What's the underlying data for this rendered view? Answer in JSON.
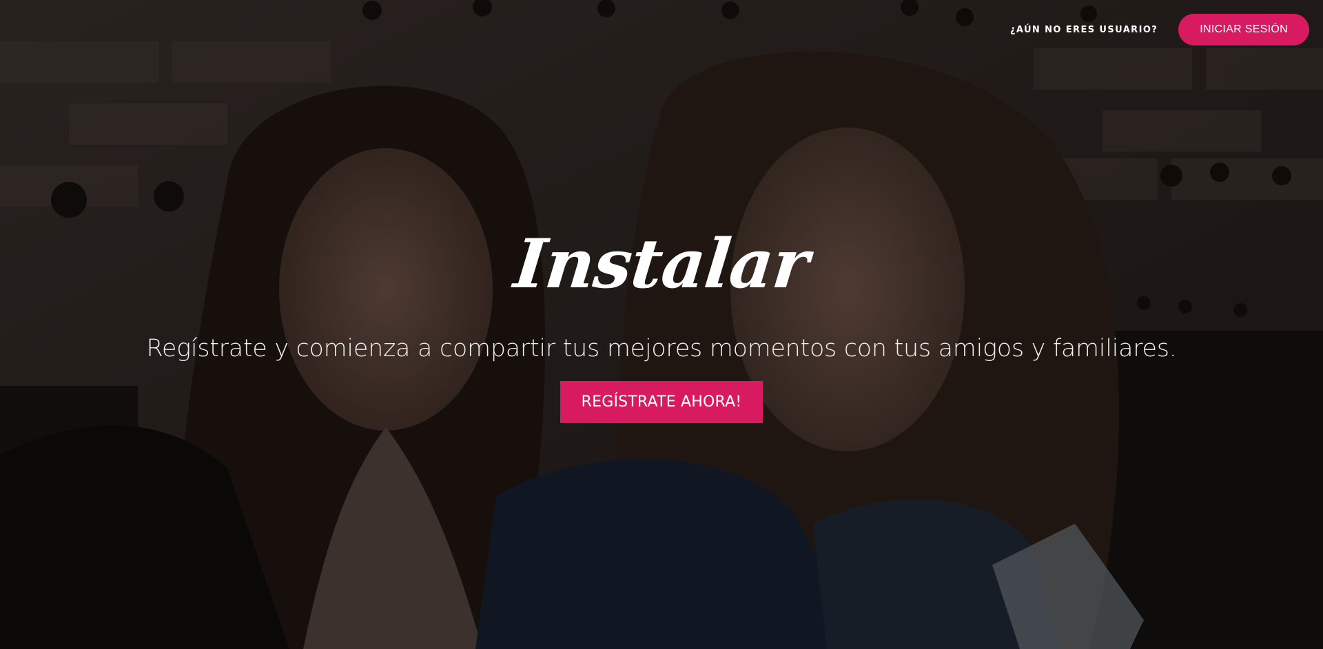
{
  "nav": {
    "signup_prompt": "¿AÚN NO ERES USUARIO?",
    "login_label": "INICIAR SESIÓN"
  },
  "hero": {
    "logo": "Instalar",
    "tagline": "Regístrate y comienza a compartir tus mejores momentos con tus amigos y familiares.",
    "register_label": "REGÍSTRATE AHORA!"
  },
  "colors": {
    "accent": "#d81b60",
    "text": "#ffffff"
  },
  "background": {
    "image": "hero-photo",
    "overlay_opacity": 0.45
  }
}
